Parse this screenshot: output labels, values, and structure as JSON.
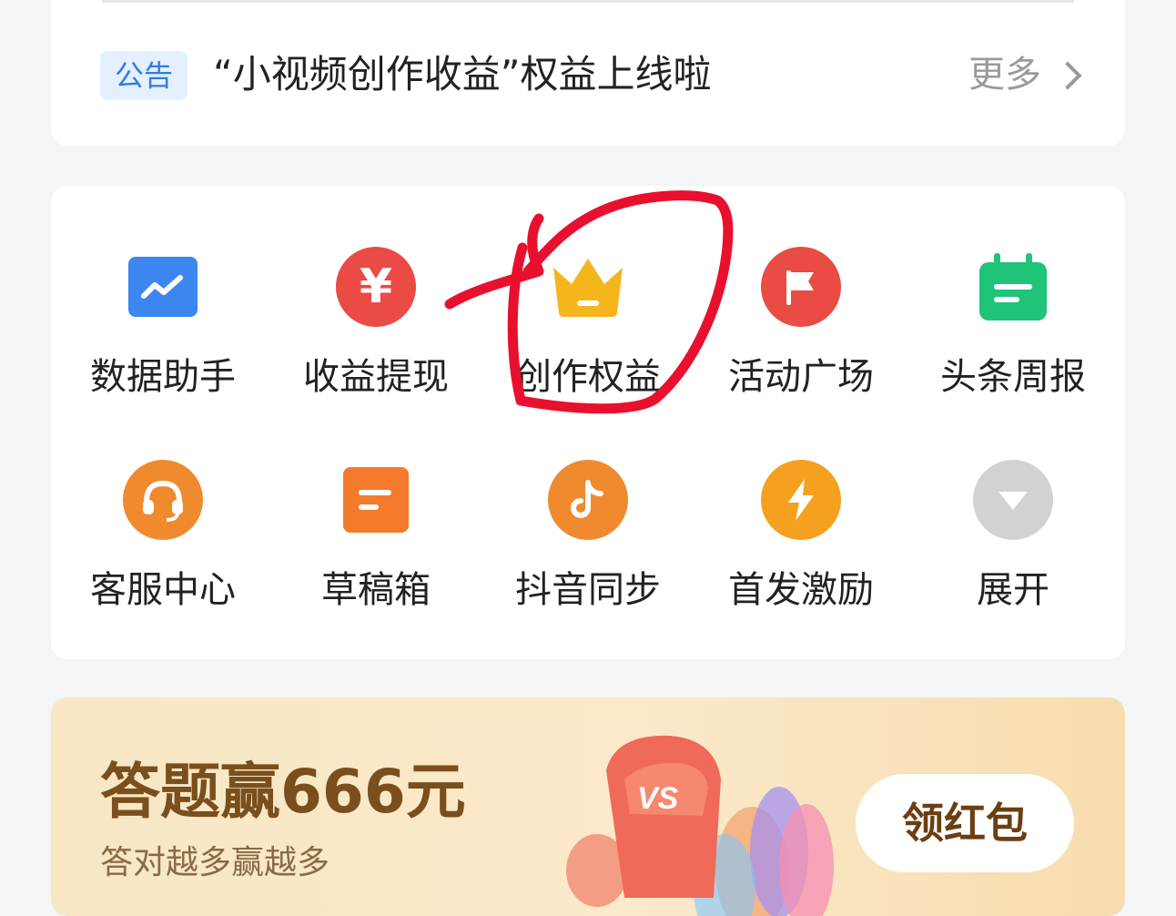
{
  "notice": {
    "tag": "公告",
    "text": "“小视频创作收益”权益上线啦",
    "more": "更多"
  },
  "tools": [
    {
      "label": "数据助手",
      "icon": "chart-trend-icon",
      "color": "#3b86f0"
    },
    {
      "label": "收益提现",
      "icon": "yuan-coin-icon",
      "color": "#ea4b45"
    },
    {
      "label": "创作权益",
      "icon": "crown-icon",
      "color": "#f4b51d"
    },
    {
      "label": "活动广场",
      "icon": "flag-icon",
      "color": "#ea4b45"
    },
    {
      "label": "头条周报",
      "icon": "calendar-icon",
      "color": "#1fc37a"
    },
    {
      "label": "客服中心",
      "icon": "headset-icon",
      "color": "#f08a2e"
    },
    {
      "label": "草稿箱",
      "icon": "draft-box-icon",
      "color": "#f37b2b"
    },
    {
      "label": "抖音同步",
      "icon": "douyin-note-icon",
      "color": "#f08a2e"
    },
    {
      "label": "首发激励",
      "icon": "lightning-icon",
      "color": "#f5a01e"
    },
    {
      "label": "展开",
      "icon": "expand-down-icon",
      "color": "#d2d2d2"
    }
  ],
  "banner": {
    "title": "答题赢666元",
    "subtitle": "答对越多赢越多",
    "button": "领红包",
    "art_text": "VS"
  },
  "annotation": {
    "color": "#e8102e"
  }
}
